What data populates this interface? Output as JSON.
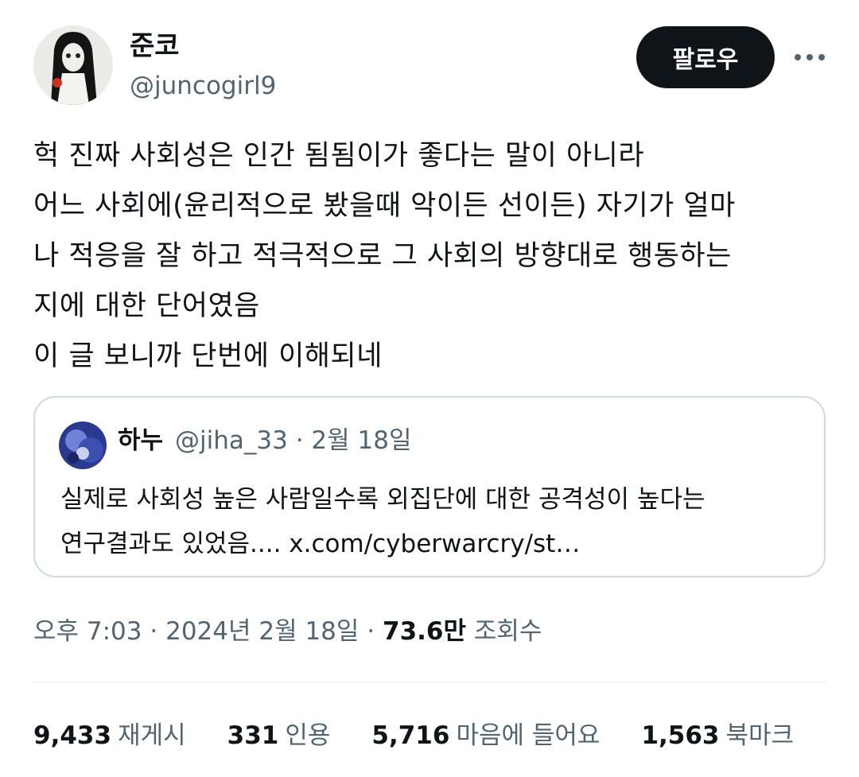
{
  "author": {
    "display_name": "준코",
    "handle": "@juncogirl9",
    "avatar_icon": "avatar-doll-icon"
  },
  "actions": {
    "follow_label": "팔로우",
    "more_icon": "more-horizontal-icon"
  },
  "tweet": {
    "lines": [
      "헉 진짜 사회성은 인간 됨됨이가 좋다는 말이 아니라",
      "어느 사회에(윤리적으로 봤을때 악이든 선이든) 자기가 얼마",
      "나 적응을 잘 하고 적극적으로 그 사회의 방향대로 행동하는",
      "지에 대한 단어였음",
      "이 글 보니까 단번에 이해되네"
    ]
  },
  "quote": {
    "display_name": "하누",
    "handle": "@jiha_33",
    "separator": "·",
    "date": "2월 18일",
    "lines": [
      "실제로 사회성 높은 사람일수록 외집단에 대한 공격성이 높다는",
      "연구결과도 있었음.... x.com/cyberwarcry/st…"
    ]
  },
  "meta": {
    "time": "오후 7:03",
    "separator": "·",
    "date": "2024년 2월 18일",
    "views_count": "73.6만",
    "views_label": "조회수"
  },
  "stats": {
    "reposts_count": "9,433",
    "reposts_label": "재게시",
    "quotes_count": "331",
    "quotes_label": "인용",
    "likes_count": "5,716",
    "likes_label": "마음에 들어요",
    "bookmarks_count": "1,563",
    "bookmarks_label": "북마크"
  },
  "colors": {
    "text": "#0f1419",
    "secondary": "#536471",
    "border": "#cfd9de",
    "button": "#0f1419"
  }
}
